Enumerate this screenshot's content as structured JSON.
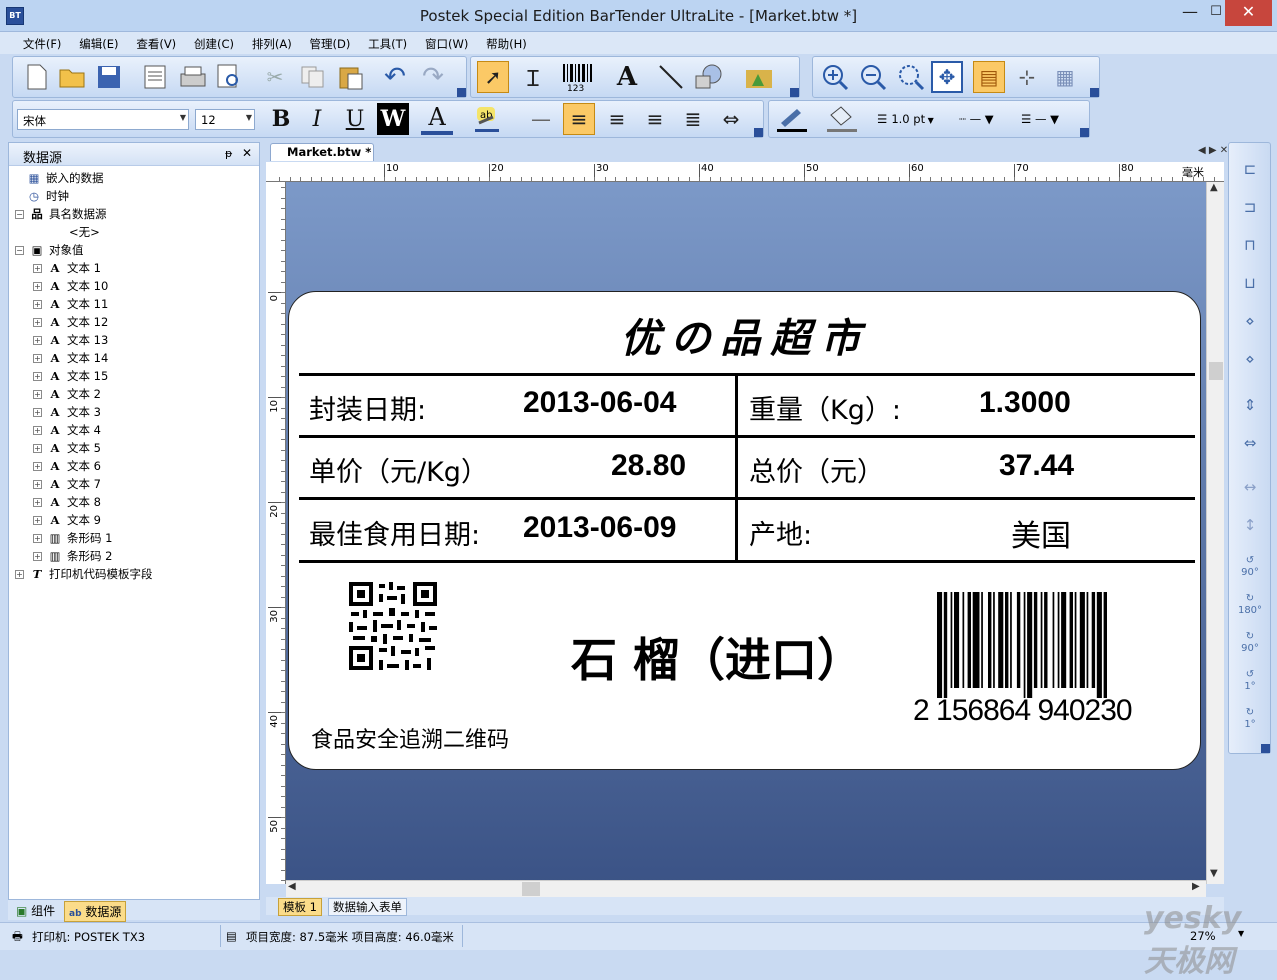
{
  "window": {
    "title": "Postek Special Edition BarTender UltraLite - [Market.btw *]",
    "app_icon": "BT",
    "minimize": "—",
    "maximize": "☐",
    "close": "✕"
  },
  "menu": [
    "文件(F)",
    "编辑(E)",
    "查看(V)",
    "创建(C)",
    "排列(A)",
    "管理(D)",
    "工具(T)",
    "窗口(W)",
    "帮助(H)"
  ],
  "format_bar": {
    "font": "宋体",
    "size": "12",
    "bold": "B",
    "italic": "I",
    "underline": "U",
    "wrap": "W",
    "line_width": "1.0 pt"
  },
  "panel": {
    "title": "数据源",
    "pin": "ᵽ",
    "close": "✕"
  },
  "tree": [
    {
      "label": "嵌入的数据",
      "icon": "embedded-data-icon",
      "level": 1,
      "expander": ""
    },
    {
      "label": "时钟",
      "icon": "clock-icon",
      "level": 1,
      "expander": ""
    },
    {
      "label": "具名数据源",
      "icon": "named-source-icon",
      "level": 0,
      "expander": "−"
    },
    {
      "label": "<无>",
      "icon": "",
      "level": 2,
      "expander": ""
    },
    {
      "label": "对象值",
      "icon": "object-value-icon",
      "level": 0,
      "expander": "−"
    },
    {
      "label": "文本 1",
      "icon": "text-icon",
      "level": 1,
      "expander": "+"
    },
    {
      "label": "文本 10",
      "icon": "text-icon",
      "level": 1,
      "expander": "+"
    },
    {
      "label": "文本 11",
      "icon": "text-icon",
      "level": 1,
      "expander": "+"
    },
    {
      "label": "文本 12",
      "icon": "text-icon",
      "level": 1,
      "expander": "+"
    },
    {
      "label": "文本 13",
      "icon": "text-icon",
      "level": 1,
      "expander": "+"
    },
    {
      "label": "文本 14",
      "icon": "text-icon",
      "level": 1,
      "expander": "+"
    },
    {
      "label": "文本 15",
      "icon": "text-icon",
      "level": 1,
      "expander": "+"
    },
    {
      "label": "文本 2",
      "icon": "text-icon",
      "level": 1,
      "expander": "+"
    },
    {
      "label": "文本 3",
      "icon": "text-icon",
      "level": 1,
      "expander": "+"
    },
    {
      "label": "文本 4",
      "icon": "text-icon",
      "level": 1,
      "expander": "+"
    },
    {
      "label": "文本 5",
      "icon": "text-icon",
      "level": 1,
      "expander": "+"
    },
    {
      "label": "文本 6",
      "icon": "text-icon",
      "level": 1,
      "expander": "+"
    },
    {
      "label": "文本 7",
      "icon": "text-icon",
      "level": 1,
      "expander": "+"
    },
    {
      "label": "文本 8",
      "icon": "text-icon",
      "level": 1,
      "expander": "+"
    },
    {
      "label": "文本 9",
      "icon": "text-icon",
      "level": 1,
      "expander": "+"
    },
    {
      "label": "条形码 1",
      "icon": "barcode-icon",
      "level": 1,
      "expander": "+"
    },
    {
      "label": "条形码 2",
      "icon": "barcode-icon",
      "level": 1,
      "expander": "+"
    },
    {
      "label": "打印机代码模板字段",
      "icon": "printer-template-icon",
      "level": 0,
      "expander": "+"
    }
  ],
  "panel_tabs": {
    "components": "组件",
    "datasource": "数据源"
  },
  "document": {
    "tab": "Market.btw *",
    "units": "毫米",
    "hruler": [
      "10",
      "20",
      "30",
      "40",
      "50",
      "60",
      "70",
      "80"
    ],
    "vruler": [
      "0",
      "10",
      "20",
      "30",
      "40",
      "50"
    ],
    "sheet_tabs": [
      "模板 1",
      "数据输入表单"
    ]
  },
  "label": {
    "title": "优の品超市",
    "pack_date_label": "封装日期:",
    "pack_date": "2013-06-04",
    "weight_label": "重量（Kg）:",
    "weight": "1.3000",
    "unit_price_label": "单价（元/Kg）",
    "unit_price": "28.80",
    "total_label": "总价（元）",
    "total": "37.44",
    "best_before_label": "最佳食用日期:",
    "best_before": "2013-06-09",
    "origin_label": "产地:",
    "origin": "美国",
    "product": "石 榴（进口）",
    "qr_caption": "食品安全追溯二维码",
    "barcode_number": "2 156864 940230"
  },
  "right_toolbar": [
    "90°",
    "180°",
    "90°",
    "1°",
    "1°"
  ],
  "status": {
    "printer": "打印机: POSTEK TX3",
    "size": "项目宽度: 87.5毫米   项目高度: 46.0毫米",
    "zoom": "27%",
    "watermark": "yesky 天极网"
  }
}
